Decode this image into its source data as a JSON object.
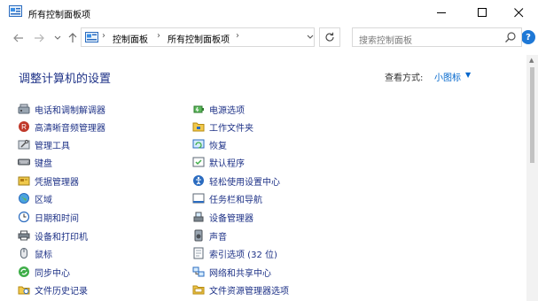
{
  "window": {
    "title": "所有控制面板项"
  },
  "address": {
    "crumbs": [
      "控制面板",
      "所有控制面板项"
    ],
    "separator": "›"
  },
  "search": {
    "placeholder": "搜索控制面板"
  },
  "page": {
    "heading": "调整计算机的设置",
    "view_by_label": "查看方式:",
    "view_by_value": "小图标"
  },
  "items_left": [
    {
      "label": "电话和调制解调器",
      "icon": "phone-modem-icon"
    },
    {
      "label": "高清晰音频管理器",
      "icon": "hd-audio-icon"
    },
    {
      "label": "管理工具",
      "icon": "admin-tools-icon"
    },
    {
      "label": "键盘",
      "icon": "keyboard-icon"
    },
    {
      "label": "凭据管理器",
      "icon": "credential-icon"
    },
    {
      "label": "区域",
      "icon": "region-icon"
    },
    {
      "label": "日期和时间",
      "icon": "clock-icon"
    },
    {
      "label": "设备和打印机",
      "icon": "printer-icon"
    },
    {
      "label": "鼠标",
      "icon": "mouse-icon"
    },
    {
      "label": "同步中心",
      "icon": "sync-icon"
    },
    {
      "label": "文件历史记录",
      "icon": "file-history-icon"
    }
  ],
  "items_right": [
    {
      "label": "电源选项",
      "icon": "power-icon"
    },
    {
      "label": "工作文件夹",
      "icon": "work-folders-icon"
    },
    {
      "label": "恢复",
      "icon": "recovery-icon"
    },
    {
      "label": "默认程序",
      "icon": "default-programs-icon"
    },
    {
      "label": "轻松使用设置中心",
      "icon": "ease-of-access-icon"
    },
    {
      "label": "任务栏和导航",
      "icon": "taskbar-icon"
    },
    {
      "label": "设备管理器",
      "icon": "device-manager-icon"
    },
    {
      "label": "声音",
      "icon": "sound-icon"
    },
    {
      "label": "索引选项 (32 位)",
      "icon": "indexing-icon"
    },
    {
      "label": "网络和共享中心",
      "icon": "network-icon"
    },
    {
      "label": "文件资源管理器选项",
      "icon": "folder-options-icon"
    }
  ],
  "colors": {
    "link": "#1e3287",
    "accent": "#0066cc",
    "help": "#1e78d6"
  }
}
